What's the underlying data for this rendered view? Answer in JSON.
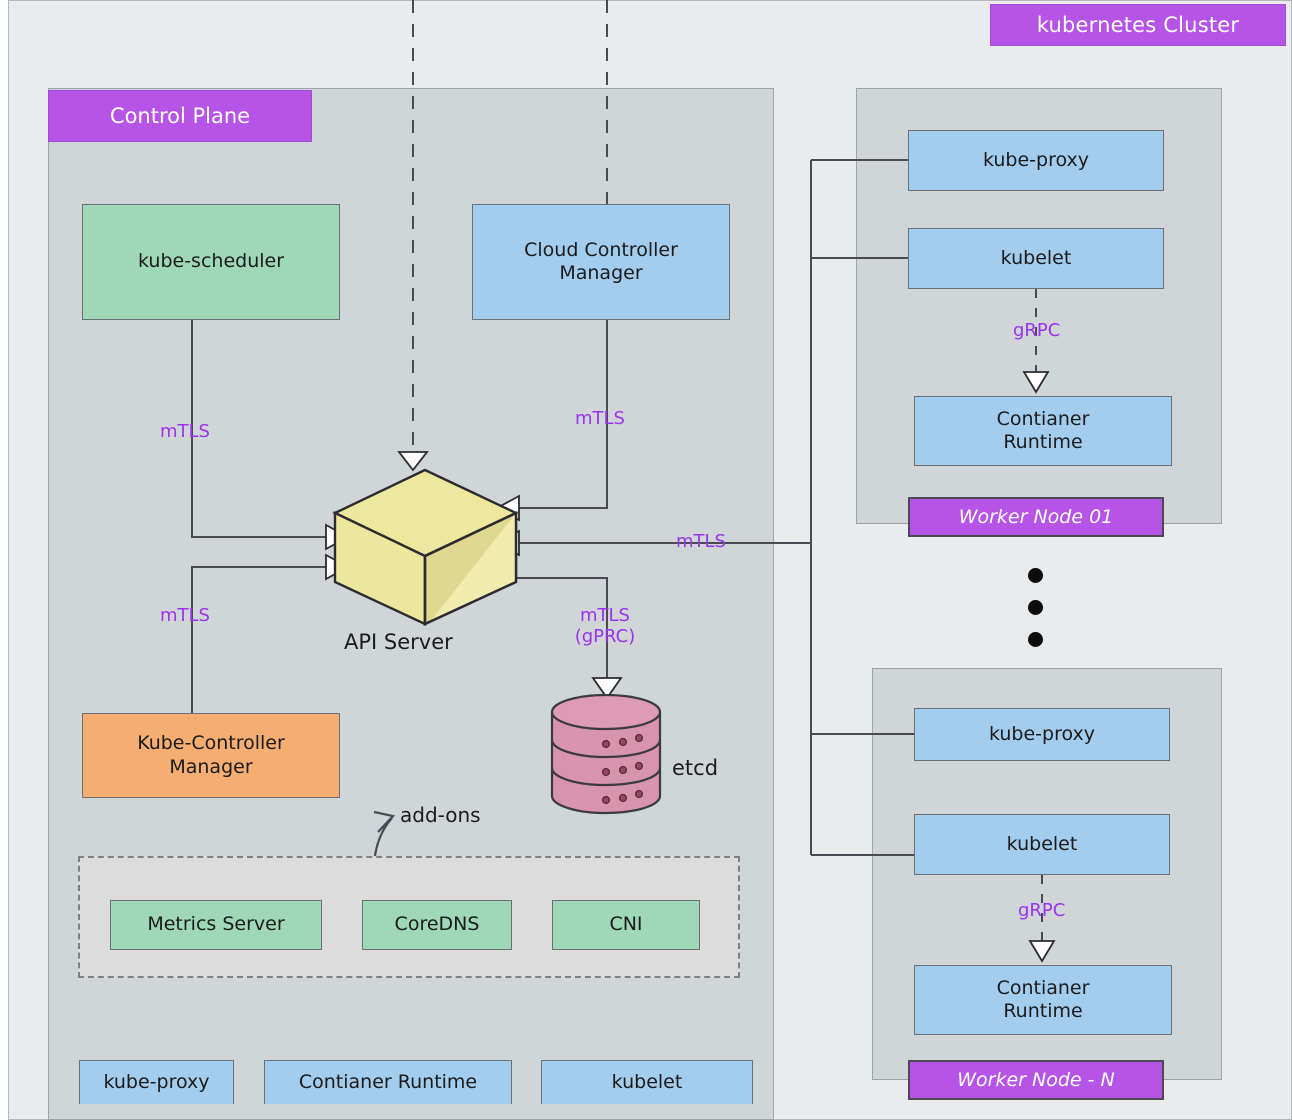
{
  "diagram": {
    "title": "kubernetes Cluster",
    "control_plane": {
      "title": "Control Plane",
      "components": [
        {
          "id": "kube-scheduler",
          "label": "kube-scheduler",
          "color": "#9ed8b8"
        },
        {
          "id": "cloud-controller-manager",
          "label": "Cloud Controller\nManager",
          "line1": "Cloud Controller",
          "line2": "Manager",
          "color": "#a3cdef"
        },
        {
          "id": "api-server",
          "label": "API Server",
          "color": "#ede89e",
          "shape": "cube"
        },
        {
          "id": "kube-controller-manager",
          "line1": "Kube-Controller",
          "line2": "Manager",
          "color": "#f5ad71"
        },
        {
          "id": "etcd",
          "label": "etcd",
          "color": "#d994ad",
          "shape": "cylinder"
        }
      ],
      "addons": {
        "annotation": "add-ons",
        "items": [
          {
            "id": "metrics-server",
            "label": "Metrics Server",
            "color": "#9ed8b8"
          },
          {
            "id": "coredns",
            "label": "CoreDNS",
            "color": "#9ed8b8"
          },
          {
            "id": "cni",
            "label": "CNI",
            "color": "#9ed8b8"
          }
        ]
      },
      "legend_row": [
        {
          "id": "kube-proxy",
          "label": "kube-proxy",
          "color": "#a3cdef"
        },
        {
          "id": "container-runtime",
          "label": "Contianer Runtime",
          "color": "#a3cdef"
        },
        {
          "id": "kubelet",
          "label": "kubelet",
          "color": "#a3cdef"
        }
      ]
    },
    "worker_nodes": [
      {
        "id": "worker-node-01",
        "title": "Worker Node 01",
        "components": [
          {
            "id": "kube-proxy",
            "label": "kube-proxy",
            "color": "#a3cdef"
          },
          {
            "id": "kubelet",
            "label": "kubelet",
            "color": "#a3cdef"
          },
          {
            "id": "container-runtime",
            "line1": "Contianer",
            "line2": "Runtime",
            "color": "#a3cdef"
          }
        ],
        "internal_link_label": "gRPC"
      },
      {
        "id": "worker-node-n",
        "title": "Worker Node - N",
        "components": [
          {
            "id": "kube-proxy",
            "label": "kube-proxy",
            "color": "#a3cdef"
          },
          {
            "id": "kubelet",
            "label": "kubelet",
            "color": "#a3cdef"
          },
          {
            "id": "container-runtime",
            "line1": "Contianer",
            "line2": "Runtime",
            "color": "#a3cdef"
          }
        ],
        "internal_link_label": "gRPC"
      }
    ],
    "edge_labels": {
      "scheduler_to_api": "mTLS",
      "ccm_to_api": "mTLS",
      "kcm_to_api": "mTLS",
      "api_to_nodes": "mTLS",
      "api_to_etcd_line1": "mTLS",
      "api_to_etcd_line2": "(gPRC)",
      "kubelet_to_runtime_node1": "gRPC",
      "kubelet_to_runtime_noden": "gRPC"
    },
    "ellipsis": "⋮",
    "colors": {
      "cluster_background": "#eaebec",
      "control_plane_background": "#d0d5d8",
      "accent_purple": "#b654e8",
      "label_purple": "#9933ee",
      "green": "#9ed8b8",
      "blue": "#a3cdef",
      "orange": "#f5ad71",
      "yellow": "#ede89e",
      "pink": "#d994ad",
      "addons_background": "#dcdcdc",
      "stroke": "#4a4a52"
    }
  }
}
